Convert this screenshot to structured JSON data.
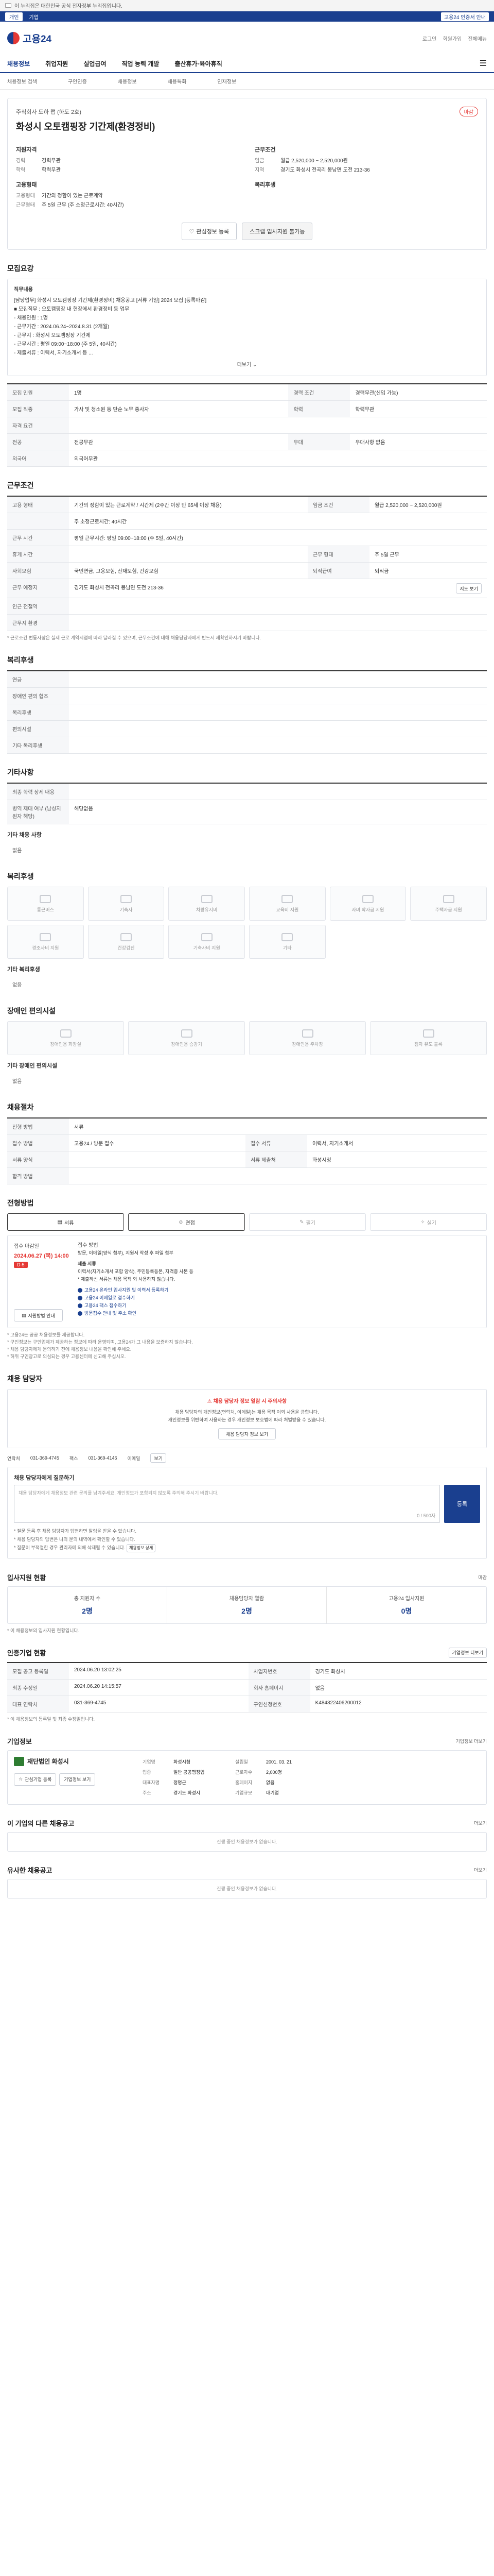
{
  "gov_banner": {
    "text": "이 누리집은 대한민국 공식 전자정부 누리집입니다."
  },
  "auth": {
    "ind": "개인",
    "corp": "기업",
    "right_badge": "고용24 인증서 안내"
  },
  "header": {
    "logo": "고용24",
    "util": [
      "로그인",
      "회원가입",
      "전체메뉴"
    ]
  },
  "gnb": {
    "items": [
      "채용정보",
      "취업지원",
      "실업급여",
      "직업 능력 개발",
      "출산휴가·육아휴직"
    ]
  },
  "breadcrumbs": [
    "채용정보 검색",
    "구인인증",
    "채용정보",
    "채용특화",
    "인재정보"
  ],
  "job": {
    "biz_name": "주식회사 도하 랩 (하도 2호)",
    "tag": "마감",
    "title": "화성시 오토캠핑장 기간제(환경정비)",
    "summary": {
      "left_title": "지원자격",
      "left": [
        [
          "경력",
          "경력무관"
        ],
        [
          "학력",
          "학력무관"
        ]
      ],
      "right_title": "근무조건",
      "right": [
        [
          "임금",
          "월급 2,520,000 ~ 2,520,000원"
        ],
        [
          "지역",
          "경기도 화성시 전곡리 봉남면 도전 213-36"
        ]
      ],
      "left2_title": "고용형태",
      "left2": [
        [
          "고용형태",
          "기간의 정함이 있는 근로계약"
        ],
        [
          "근무형태",
          "주 5일 근무 (주 소정근로시간: 40시간)"
        ]
      ],
      "right2_title": "복리후생",
      "right2": []
    },
    "btn_scrap": "관심정보 등록",
    "btn_apply": "스크랩 입사지원 불가능"
  },
  "duty": {
    "title": "모집요강",
    "label": "직무내용",
    "lines": [
      "[담당업무] 화성시 오토캠핑장 기간제(환경정비) 채용공고 [서류 기일] 2024 모집 [등록마감]",
      "■ 모집직무 : 오토캠핑장 내 현장에서 환경정비 등 업무",
      "  - 채용인원 : 1명",
      "  - 근무기간 : 2024.06.24~2024.8.31 (2개월)",
      "  - 근무지 : 화성시 오토캠핑장 기간제",
      "",
      "  - 근무시간 : 평일 09:00~18:00 (주 5일, 40시간)",
      "",
      "- 제출서류 : 이력서, 자기소개서 등 ..."
    ],
    "more": "더보기"
  },
  "recruit_table": [
    [
      "모집 인원",
      "1명",
      "경력 조건",
      "경력무관(신입 가능)"
    ],
    [
      "모집 직종",
      "가사 및 청소원 등 단순 노무 종사자",
      "학력",
      "학력무관"
    ],
    [
      "자격 요건",
      "",
      "",
      ""
    ],
    [
      "전공",
      "전공무관",
      "우대",
      "우대사항 없음"
    ],
    [
      "외국어",
      "외국어무관",
      "",
      ""
    ]
  ],
  "condition": {
    "title": "근무조건",
    "rows": [
      [
        "고용 형태",
        "기간의 정함이 있는 근로계약 / 시간제 (2주간 이상 만 65세 이상 채용)",
        "임금 조건",
        "월급 2,520,000 ~ 2,520,000원"
      ],
      [
        "",
        "주 소정근로시간: 40시간",
        "",
        ""
      ],
      [
        "근무 시간",
        "평일 근무시간: 평일 09:00~18:00 (주 5일, 40시간)",
        "",
        ""
      ],
      [
        "휴게 시간",
        "",
        "근무 형태",
        "주 5일 근무"
      ],
      [
        "사회보험",
        "국민연금, 고용보험, 산재보험, 건강보험",
        "퇴직급여",
        "퇴직금"
      ],
      [
        "근무 예정지",
        "경기도 화성시 전곡리 봉남면 도전 213-36",
        "",
        ""
      ],
      [
        "인근 전철역",
        "",
        "",
        ""
      ],
      [
        "근무지 환경",
        "",
        "",
        ""
      ]
    ],
    "map_button": "지도 보기",
    "note": "* 근로조건 변동사항은 실제 근로 계약시점에 따라 달라질 수 있으며, 근무조건에 대해 채용담당자에게 반드시 재확인하시기 바랍니다."
  },
  "welfare": {
    "title": "복리후생",
    "rows": [
      [
        "연금",
        ""
      ],
      [
        "장애인 편의 협조",
        ""
      ],
      [
        "복리후생",
        ""
      ],
      [
        "편의시설",
        ""
      ],
      [
        "기타 복리후생",
        ""
      ]
    ],
    "rows_values": [
      "",
      "",
      "",
      "",
      ""
    ]
  },
  "etc": {
    "title": "기타사항",
    "rows": [
      [
        "최종 학력 상세 내용",
        ""
      ],
      [
        "병역 제대 여부 (남성지원자 해당)",
        "해당없음"
      ]
    ],
    "note_title": "기타 채용 사항",
    "note": "없음"
  },
  "icons1": {
    "title": "복리후생",
    "items": [
      "통근버스",
      "기숙사",
      "차량유지비",
      "교육비 지원",
      "자녀 학자금 지원",
      "주택자금 지원",
      "경조사비 지원",
      "건강검진",
      "기숙사비 지원",
      "기타"
    ],
    "etc_label": "기타 복리후생",
    "etc_value": "없음"
  },
  "icons2": {
    "title": "장애인 편의시설",
    "items": [
      "장애인용 화장실",
      "장애인용 승강기",
      "장애인용 주차장",
      "점자 유도 블록"
    ],
    "etc_label": "기타 장애인 편의시설",
    "etc_value": "없음"
  },
  "process": {
    "title": "채용절차",
    "rows": [
      [
        "전형 방법",
        "서류",
        "",
        ""
      ],
      [
        "접수 방법",
        "",
        "",
        ""
      ],
      [
        "제출 서류",
        "",
        "제출서류 준비물",
        "이력서, 자기소개서"
      ],
      [
        "합격 방법",
        "",
        "",
        ""
      ]
    ],
    "rows2": [
      [
        "접수 방법",
        "고용24 / 방문 접수",
        "접수 서류",
        "이력서, 자기소개서"
      ],
      [
        "서류 양식",
        "",
        "서류 제출처",
        "화성시청"
      ]
    ]
  },
  "apply": {
    "title": "전형방법",
    "options": [
      "서류",
      "면접",
      "필기",
      "실기"
    ],
    "deadline_label": "접수 마감일",
    "deadline": "2024.06.27 (목) 14:00",
    "dday": "D-5",
    "method_label": "접수 방법",
    "method": "방문, 이메일(양식 첨부), 지원서 작성 후 파일 첨부",
    "apply_items_title": "제출 서류",
    "apply_items": [
      "이력서(자기소개서 포함 양식), 주민등록등본, 자격증 사본 등",
      "* 제출하신 서류는 채용 목적 외 사용하지 않습니다."
    ],
    "links": [
      "고용24 온라인 입사지원 및 이력서 등록하기",
      "고용24 이메일로 접수하기",
      "고용24 팩스 접수하기",
      "방문접수 안내 및 주소 확인"
    ],
    "button": "지원방법 안내"
  },
  "notes": [
    "* 고용24는 공공 채용정보를 제공합니다.",
    "* 구인정보는 구인업체가 제공하는 정보에 따라 운영되며, 고용24가 그 내용을 보증하지 않습니다.",
    "* 채용 담당자에게 문의하기 전에 채용정보 내용을 확인해 주세요.",
    "* 허위 구인광고로 의심되는 경우 고용센터에 신고해 주십시오."
  ],
  "manager": {
    "title": "채용 담당자",
    "alert_title": "채용 담당자 정보 열람 시 주의사항",
    "alert_lines": [
      "채용 담당자의 개인정보(연락처, 이메일)는 채용 목적 이외 사용을 금합니다.",
      "개인정보를 위반하여 사용하는 경우 개인정보 보호법에 따라 처벌받을 수 있습니다."
    ],
    "alert_btn": "채용 담당자 정보 보기",
    "contact_label": "연락처",
    "phone": "031-369-4745",
    "fax_label": "팩스",
    "fax": "031-369-4146",
    "email_label": "이메일",
    "email_btn": "보기"
  },
  "inquiry": {
    "title": "채용 담당자에게 질문하기",
    "placeholder": "채용 담당자에게 채용정보 관련 문의를 남겨주세요. 개인정보가 포함되지 않도록 주의해 주시기 바랍니다.",
    "count": "0 / 500자",
    "send": "등록",
    "tips": [
      "* 질문 등록 후 채용 담당자가 답변하면 알림을 받을 수 있습니다.",
      "* 채용 담당자의 답변은 나의 문의 내역에서 확인할 수 있습니다.",
      "* 질문이 부적절한 경우 관리자에 의해 삭제될 수 있습니다."
    ],
    "more_btn": "채용정보 상세"
  },
  "applicants": {
    "title": "입사지원 현황",
    "right": "마감",
    "stats": [
      [
        "총 지원자 수",
        "2명"
      ],
      [
        "채용담당자 열람",
        "2명"
      ],
      [
        "고용24 입사지원",
        "0명"
      ]
    ],
    "note": "* 이 채용정보의 입사지원 현황입니다."
  },
  "corp_info": {
    "title": "인증기업 현황",
    "right": "기업정보 더보기",
    "rows": [
      [
        "모집 공고 등록일",
        "2024.06.20 13:02:25",
        "사업자번호",
        "경기도 화성시"
      ],
      [
        "최종 수정일",
        "2024.06.20 14:15:57",
        "회사 홈페이지",
        "없음"
      ],
      [
        "대표 연락처",
        "031-369-4745",
        "구인신청번호",
        "K484322406200012"
      ]
    ],
    "note": "* 이 채용정보의 등록일 및 최종 수정일입니다."
  },
  "company": {
    "title": "기업정보",
    "right": "기업정보 더보기",
    "name": "재단법인 화성시",
    "btns": [
      "관심기업 등록",
      "기업정보 보기"
    ],
    "info": [
      [
        "기업명",
        "화성시청"
      ],
      [
        "업종",
        "일반 공공행정업"
      ],
      [
        "대표자명",
        "정명근"
      ],
      [
        "주소",
        "경기도 화성시"
      ],
      [
        "설립일",
        "2001. 03. 21"
      ],
      [
        "근로자수",
        "2,000명"
      ],
      [
        "홈페이지",
        "없음"
      ],
      [
        "기업규모",
        "대기업"
      ]
    ]
  },
  "other_jobs": {
    "title": "이 기업의 다른 채용공고",
    "right": "더보기",
    "empty": "진행 중인 채용정보가 없습니다."
  },
  "similar_jobs": {
    "title": "유사한 채용공고",
    "right": "더보기",
    "empty": "진행 중인 채용정보가 없습니다."
  }
}
